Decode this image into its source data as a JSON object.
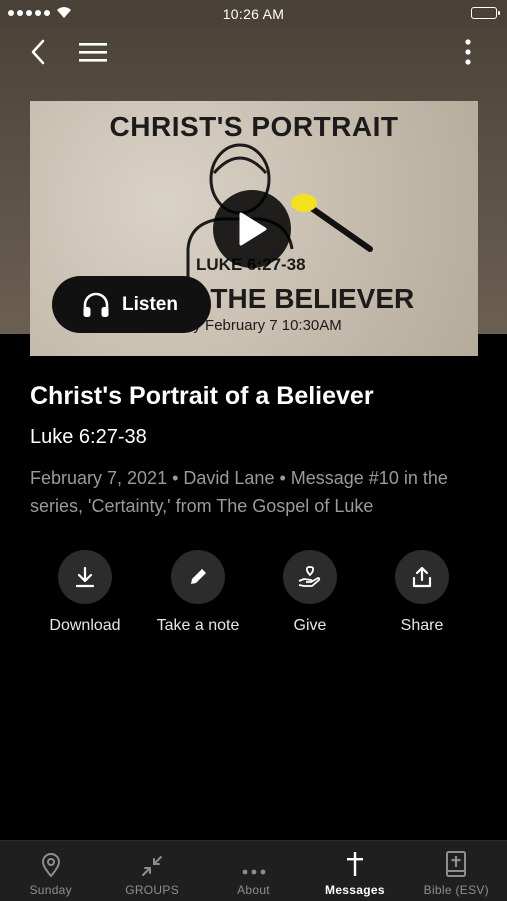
{
  "status_bar": {
    "time": "10:26 AM"
  },
  "hero": {
    "title": "CHRIST'S PORTRAIT",
    "reference": "LUKE 6:27-38",
    "subtitle": "OF THE BELIEVER",
    "date_line": "Sunday February 7 10:30AM"
  },
  "listen_label": "Listen",
  "message": {
    "title": "Christ's Portrait of a Believer",
    "scripture": "Luke 6:27-38",
    "meta": "February 7, 2021 • David Lane • Message #10 in the series, 'Certainty,' from The Gospel of Luke"
  },
  "actions": [
    {
      "label": "Download",
      "icon": "download-icon"
    },
    {
      "label": "Take a note",
      "icon": "pencil-icon"
    },
    {
      "label": "Give",
      "icon": "give-hand-heart-icon"
    },
    {
      "label": "Share",
      "icon": "share-icon"
    }
  ],
  "tabs": [
    {
      "label": "Sunday",
      "icon": "location-pin-icon",
      "active": false
    },
    {
      "label": "GROUPS",
      "icon": "collapse-arrows-icon",
      "active": false
    },
    {
      "label": "About",
      "icon": "more-dots-icon",
      "active": false
    },
    {
      "label": "Messages",
      "icon": "cross-icon",
      "active": true
    },
    {
      "label": "Bible (ESV)",
      "icon": "bible-icon",
      "active": false
    }
  ],
  "colors": {
    "header_brown": "#4d4439",
    "background": "#000000",
    "tabbar": "#1f1f1f",
    "accent_yellow": "#f3e21b"
  }
}
